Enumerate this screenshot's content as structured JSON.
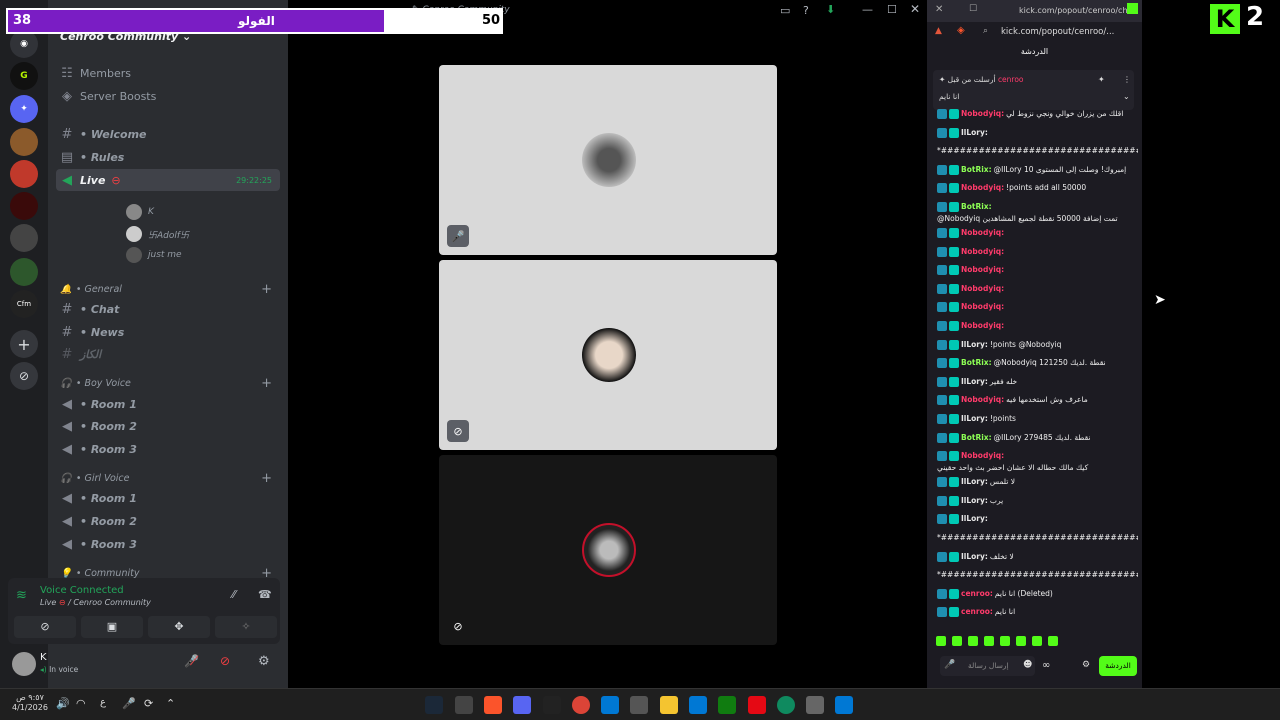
{
  "overlay": {
    "left_count": "38",
    "label": "الفولو",
    "right_count": "50"
  },
  "window": {
    "title": "Cenroo Community"
  },
  "server": {
    "name": "Cenroo Community",
    "chevron": "⌄"
  },
  "nav": {
    "members": "Members",
    "boosts": "Server Boosts"
  },
  "channels": {
    "welcome": "• Welcome",
    "rules": "• Rules",
    "live": "Live",
    "live_time": "29:22:25",
    "chat": "• Chat",
    "news": "• News",
    "other": "الكاز"
  },
  "voice_users": [
    "K",
    "卐Adolf卐",
    "just me"
  ],
  "categories": {
    "general": "• General",
    "boy": "• Boy Voice",
    "girl": "• Girl Voice",
    "community": "• Community"
  },
  "rooms": {
    "boy": [
      "• Room 1",
      "• Room 2",
      "• Room 3"
    ],
    "girl": [
      "• Room 1",
      "• Room 2",
      "• Room 3"
    ]
  },
  "voice_panel": {
    "status": "Voice Connected",
    "channel": "Live",
    "server": "/ Cenroo Community"
  },
  "user": {
    "name": "K",
    "status": "In voice"
  },
  "browser": {
    "tab_url": "kick.com/popout/cenroo/ch...",
    "address": "kick.com/popout/cenroo/...",
    "chat_title": "الدردشة",
    "pinned_by": "أرسلت من قبل",
    "pinned_user": "cenroo",
    "pinned_text": "انا نايم"
  },
  "messages": [
    {
      "user": "Nobodyiq",
      "color": "red",
      "text": "اقلك من يزران خوالي ونجي نزوط لي"
    },
    {
      "user": "IlLory",
      "color": "white",
      "text": ""
    },
    {
      "user": "",
      "color": "white",
      "text": "*#####################################*"
    },
    {
      "user": "BotRix",
      "color": "green",
      "text": "@IlLory 10 إمبروك! وصلت إلى المستوى"
    },
    {
      "user": "Nobodyiq",
      "color": "red",
      "text": "!points add all 50000"
    },
    {
      "user": "BotRix",
      "color": "green",
      "text": "@Nobodyiq تمت إضافة 50000 نقطة لجميع المشاهدين"
    },
    {
      "user": "Nobodyiq",
      "color": "red",
      "text": ""
    },
    {
      "user": "Nobodyiq",
      "color": "red",
      "text": ""
    },
    {
      "user": "Nobodyiq",
      "color": "red",
      "text": ""
    },
    {
      "user": "Nobodyiq",
      "color": "red",
      "text": ""
    },
    {
      "user": "Nobodyiq",
      "color": "red",
      "text": ""
    },
    {
      "user": "Nobodyiq",
      "color": "red",
      "text": ""
    },
    {
      "user": "IlLory",
      "color": "white",
      "text": "!points @Nobodyiq"
    },
    {
      "user": "BotRix",
      "color": "green",
      "text": "@Nobodyiq 121250 نقطة .لديك"
    },
    {
      "user": "IlLory",
      "color": "white",
      "text": "خله فقير"
    },
    {
      "user": "Nobodyiq",
      "color": "red",
      "text": "ماعرف وش استخدمها فيه"
    },
    {
      "user": "IlLory",
      "color": "white",
      "text": "!points"
    },
    {
      "user": "BotRix",
      "color": "green",
      "text": "@IlLory 279485 نقطة .لديك"
    },
    {
      "user": "Nobodyiq",
      "color": "red",
      "text": "كيك مالك حطاله الا عشان احضر بث واحد حقيني"
    },
    {
      "user": "IlLory",
      "color": "white",
      "text": "لا تلمس"
    },
    {
      "user": "IlLory",
      "color": "white",
      "text": "يرب"
    },
    {
      "user": "IlLory",
      "color": "white",
      "text": ""
    },
    {
      "user": "",
      "color": "white",
      "text": "*#####################################*"
    },
    {
      "user": "IlLory",
      "color": "white",
      "text": "لا تخلف"
    },
    {
      "user": "",
      "color": "white",
      "text": "*#####################################*"
    },
    {
      "user": "cenroo",
      "color": "red",
      "text": "انا نايم (Deleted)"
    },
    {
      "user": "cenroo",
      "color": "red",
      "text": "انا نايم"
    }
  ],
  "chat_input": {
    "placeholder": "إرسال رسالة",
    "send": "الدردشة"
  },
  "taskbar": {
    "time": "٩:٥٧ ص",
    "date": "4/1/2026",
    "lang": "ع"
  },
  "kick_logo": {
    "letter": "K",
    "number": "2"
  }
}
